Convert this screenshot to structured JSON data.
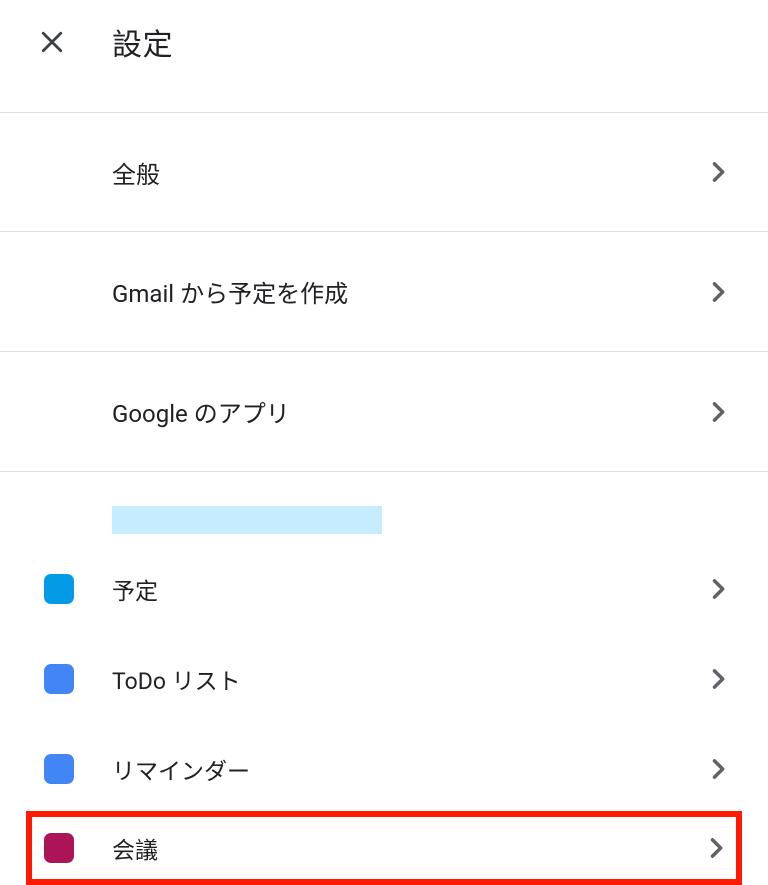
{
  "header": {
    "title": "設定"
  },
  "sections": {
    "general": {
      "label": "全般"
    },
    "gmail_events": {
      "label": "Gmail から予定を作成"
    },
    "google_apps": {
      "label": "Google のアプリ"
    }
  },
  "calendars": {
    "yotei": {
      "label": "予定",
      "color": "#039be5"
    },
    "todo": {
      "label": "ToDo リスト",
      "color": "#4285f4"
    },
    "reminder": {
      "label": "リマインダー",
      "color": "#4285f4"
    },
    "meeting": {
      "label": "会議",
      "color": "#ad1457"
    }
  }
}
